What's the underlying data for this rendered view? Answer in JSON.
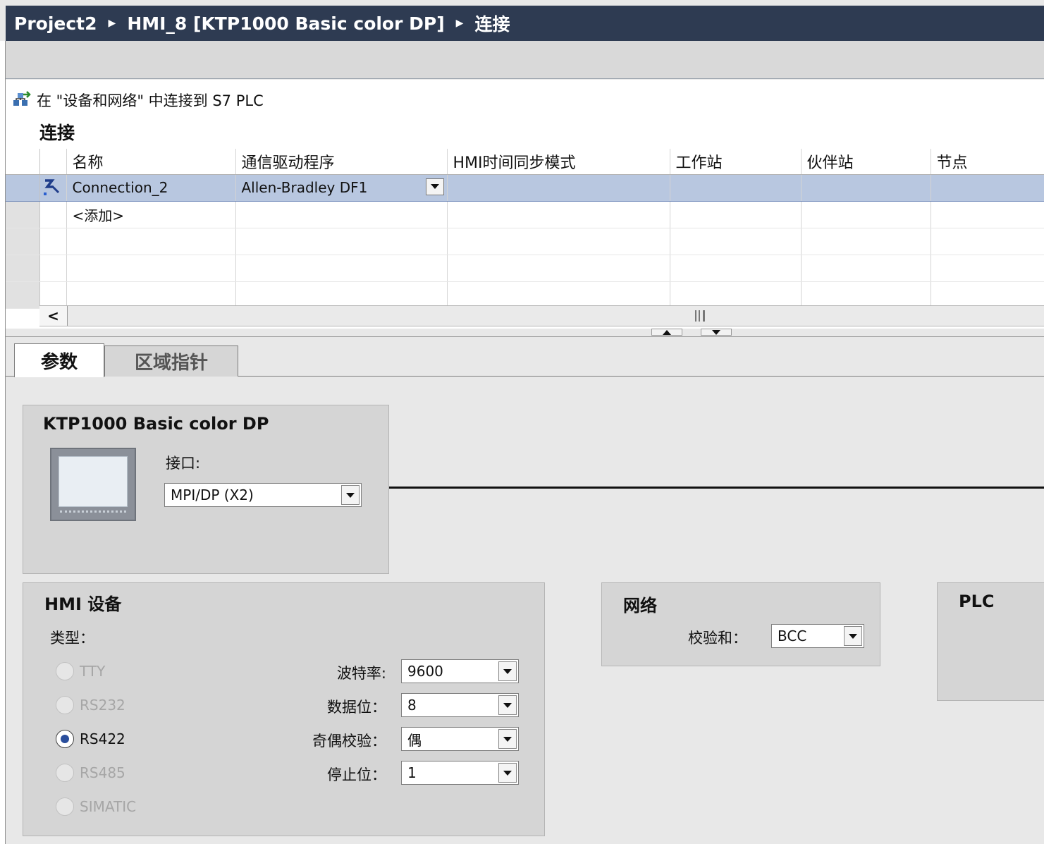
{
  "breadcrumb": {
    "project": "Project2",
    "device": "HMI_8 [KTP1000 Basic color DP]",
    "page": "连接"
  },
  "toolbar": {
    "connect_link": "在 \"设备和网络\" 中连接到 S7 PLC"
  },
  "connections": {
    "title": "连接",
    "columns": [
      "名称",
      "通信驱动程序",
      "HMI时间同步模式",
      "工作站",
      "伙伴站",
      "节点"
    ],
    "rows": [
      {
        "name": "Connection_2",
        "driver": "Allen-Bradley DF1",
        "sync_mode": "",
        "station": "",
        "partner": "",
        "node": ""
      }
    ],
    "add_label": "<添加>"
  },
  "tabs": {
    "params": "参数",
    "area_pointer": "区域指针"
  },
  "device_panel": {
    "title": "KTP1000 Basic color DP",
    "interface_label": "接口:",
    "interface_value": "MPI/DP (X2)"
  },
  "hmi_panel": {
    "title": "HMI 设备",
    "type_label": "类型：",
    "types": [
      {
        "label": "TTY",
        "selected": false
      },
      {
        "label": "RS232",
        "selected": false
      },
      {
        "label": "RS422",
        "selected": true
      },
      {
        "label": "RS485",
        "selected": false
      },
      {
        "label": "SIMATIC",
        "selected": false
      }
    ],
    "baud_label": "波特率:",
    "baud_value": "9600",
    "databits_label": "数据位：",
    "databits_value": "8",
    "parity_label": "奇偶校验：",
    "parity_value": "偶",
    "stopbits_label": "停止位：",
    "stopbits_value": "1"
  },
  "network_panel": {
    "title": "网络",
    "checksum_label": "校验和：",
    "checksum_value": "BCC"
  },
  "plc_panel": {
    "title": "PLC"
  },
  "colors": {
    "titlebar": "#2e3b52",
    "selection": "#b8c7e0",
    "radio_selected": "#2a4e9c"
  }
}
